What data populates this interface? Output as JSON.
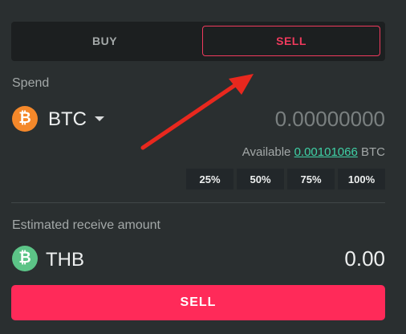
{
  "tabs": [
    {
      "label": "BUY",
      "active": false
    },
    {
      "label": "SELL",
      "active": true
    }
  ],
  "spend": {
    "label": "Spend",
    "coin": "BTC",
    "coin_glyph": "₿",
    "coin_color": "#f4882a",
    "amount_placeholder": "0.00000000",
    "available_prefix": "Available",
    "available_balance": "0.00101066",
    "available_unit": "BTC",
    "percent_options": [
      "25%",
      "50%",
      "75%",
      "100%"
    ]
  },
  "receive": {
    "label": "Estimated receive amount",
    "coin": "THB",
    "coin_glyph": "₿",
    "coin_color": "#5cc487",
    "amount": "0.00"
  },
  "action": {
    "label": "SELL",
    "color": "#ff2a59"
  },
  "annotation": {
    "type": "arrow",
    "color": "#e8281e",
    "target": "tab-sell"
  }
}
